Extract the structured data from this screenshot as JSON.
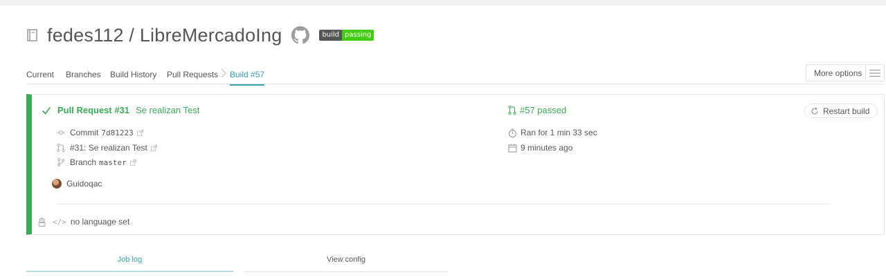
{
  "repo": {
    "owner": "fedes112",
    "separator": "/",
    "name": "LibreMercadoIng",
    "badge_left": "build",
    "badge_right": "passing"
  },
  "nav": {
    "tabs": [
      {
        "label": "Current"
      },
      {
        "label": "Branches"
      },
      {
        "label": "Build History"
      },
      {
        "label": "Pull Requests"
      },
      {
        "label": "Build #57"
      }
    ],
    "more_options": "More options"
  },
  "build": {
    "pr_label": "Pull Request #31",
    "pr_title": "Se realizan Test",
    "commit_label": "Commit",
    "commit_hash": "7d81223",
    "pr_ref": "#31: Se realizan Test",
    "branch_label": "Branch",
    "branch_name": "master",
    "author": "Guidoqac",
    "language": "no language set",
    "language_code_glyph": "</>",
    "status": "#57 passed",
    "duration": "Ran for 1 min 33 sec",
    "finished": "9 minutes ago",
    "restart": "Restart build",
    "accent_color": "#39aa56"
  },
  "bottom_tabs": {
    "job_log": "Job log",
    "view_config": "View config"
  },
  "colors": {
    "link": "#39a0ae",
    "passed": "#39aa56"
  }
}
